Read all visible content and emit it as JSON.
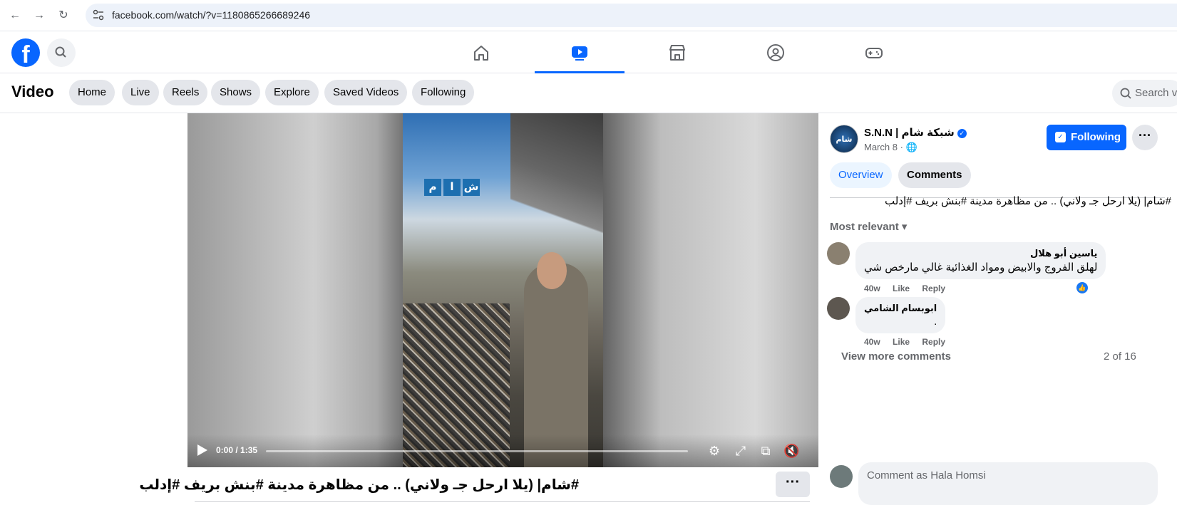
{
  "browser": {
    "url": "facebook.com/watch/?v=1180865266689246"
  },
  "top_nav": {
    "logo": "f",
    "items": [
      "home-icon",
      "watch-icon",
      "marketplace-icon",
      "groups-icon",
      "gaming-icon"
    ],
    "active": "watch-icon"
  },
  "video_header": {
    "title": "Video",
    "pills": [
      "Home",
      "Live",
      "Reels",
      "Shows",
      "Explore",
      "Saved Videos",
      "Following"
    ],
    "search_placeholder": "Search vi"
  },
  "player": {
    "overlay_logo": [
      "ش",
      "ا",
      "م"
    ],
    "time": "0:00 / 1:35",
    "progress": 0
  },
  "caption": {
    "text": "#شام| (يلا ارحل جـ ولاني) .. من مظاهرة مدينة #بنش بريف #إدلب",
    "more": "···"
  },
  "post": {
    "page_name": "S.N.N | شبكة شام",
    "date": "March 8 ·",
    "follow_label": "Following",
    "more": "···",
    "tabs": [
      "Overview",
      "Comments"
    ],
    "text": "#شام| (يلا ارحل جـ ولاني) .. من مظاهرة مدينة #بنش بريف #إدلب",
    "sort_label": "Most relevant"
  },
  "comments": [
    {
      "author": "ياسين أبو هلال",
      "text": "لهلق الفروج والابيض ومواد الغذائية غالي مارخص شي",
      "time": "40w",
      "like": "Like",
      "reply": "Reply"
    },
    {
      "author": "ابوبسام الشامي",
      "text": ".",
      "time": "40w",
      "like": "Like",
      "reply": "Reply"
    }
  ],
  "comments_footer": {
    "view_more": "View more comments",
    "count": "2 of 16"
  },
  "comment_input": {
    "placeholder": "Comment as Hala Homsi"
  }
}
